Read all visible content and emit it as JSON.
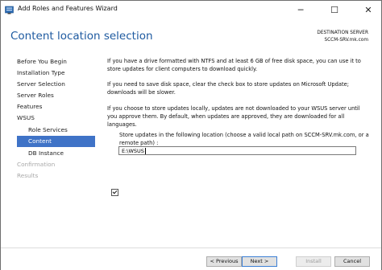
{
  "window": {
    "title": "Add Roles and Features Wizard",
    "minimize_glyph": "─",
    "maximize_glyph": "☐",
    "close_glyph": "✕"
  },
  "header": {
    "page_title": "Content location selection",
    "destination_label": "DESTINATION SERVER",
    "destination_server": "SCCM-SRV.mk.com"
  },
  "nav": {
    "items": [
      {
        "label": "Before You Begin",
        "state": "normal"
      },
      {
        "label": "Installation Type",
        "state": "normal"
      },
      {
        "label": "Server Selection",
        "state": "normal"
      },
      {
        "label": "Server Roles",
        "state": "normal"
      },
      {
        "label": "Features",
        "state": "normal"
      },
      {
        "label": "WSUS",
        "state": "normal"
      },
      {
        "label": "Role Services",
        "state": "sub"
      },
      {
        "label": "Content",
        "state": "active"
      },
      {
        "label": "DB Instance",
        "state": "sub"
      },
      {
        "label": "Confirmation",
        "state": "disabled"
      },
      {
        "label": "Results",
        "state": "disabled"
      }
    ]
  },
  "content": {
    "para1": "If you have a drive formatted with NTFS and at least 6 GB of free disk space, you can use it to store updates for client computers to download quickly.",
    "para2": "If you need to save disk space, clear the check box to store updates on Microsoft Update; downloads will be slower.",
    "para3": "If you choose to store updates locally, updates are not downloaded to your WSUS server until you approve them. By default, when updates are approved, they are downloaded for all languages.",
    "checkbox_label": "Store updates in the following location (choose a valid local path on SCCM-SRV.mk.com, or a remote path) :",
    "checkbox_checked": true,
    "path_value": "E:\\WSUS"
  },
  "footer": {
    "previous_label": "< Previous",
    "next_label": "Next >",
    "install_label": "Install",
    "cancel_label": "Cancel"
  },
  "colors": {
    "title_blue": "#1e5aa0",
    "nav_active_bg": "#3f73c7"
  }
}
